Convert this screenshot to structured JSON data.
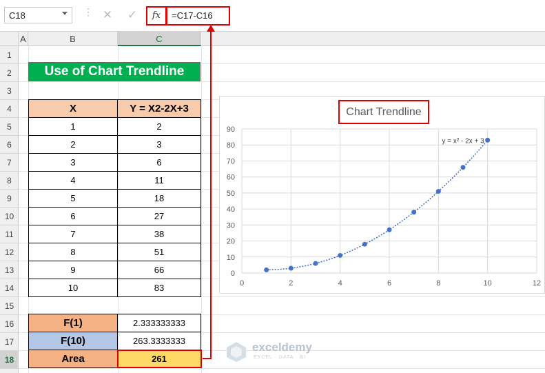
{
  "formula_bar": {
    "name_box": "C18",
    "fx_label": "fx",
    "formula": "=C17-C16",
    "cancel_glyph": "✕",
    "enter_glyph": "✓"
  },
  "columns": [
    "A",
    "B",
    "C"
  ],
  "rows": [
    "1",
    "2",
    "3",
    "4",
    "5",
    "6",
    "7",
    "8",
    "9",
    "10",
    "11",
    "12",
    "13",
    "14",
    "15",
    "16",
    "17",
    "18"
  ],
  "sheet": {
    "title": "Use of Chart Trendline",
    "table_headers": [
      "X",
      "Y = X2-2X+3"
    ],
    "table_rows": [
      [
        "1",
        "2"
      ],
      [
        "2",
        "3"
      ],
      [
        "3",
        "6"
      ],
      [
        "4",
        "11"
      ],
      [
        "5",
        "18"
      ],
      [
        "6",
        "27"
      ],
      [
        "7",
        "38"
      ],
      [
        "8",
        "51"
      ],
      [
        "9",
        "66"
      ],
      [
        "10",
        "83"
      ]
    ],
    "f1_label": "F(1)",
    "f1_value": "2.333333333",
    "f10_label": "F(10)",
    "f10_value": "263.3333333",
    "area_label": "Area",
    "area_value": "261"
  },
  "chart_data": {
    "type": "scatter",
    "title": "Chart Trendline",
    "x": [
      1,
      2,
      3,
      4,
      5,
      6,
      7,
      8,
      9,
      10
    ],
    "y": [
      2,
      3,
      6,
      11,
      18,
      27,
      38,
      51,
      66,
      83
    ],
    "trendline": "polynomial",
    "trendline_equation": "y = x² - 2x + 3",
    "xlim": [
      0,
      12
    ],
    "ylim": [
      0,
      90
    ],
    "x_ticks": [
      "0",
      "2",
      "4",
      "6",
      "8",
      "10",
      "12"
    ],
    "y_ticks": [
      "0",
      "10",
      "20",
      "30",
      "40",
      "50",
      "60",
      "70",
      "80",
      "90"
    ],
    "grid": true,
    "point_color": "#4472c4",
    "trend_color": "#4472c4"
  },
  "watermark": {
    "name": "exceldemy",
    "tagline": "EXCEL · DATA · BI"
  },
  "colors": {
    "highlight_red": "#e00000",
    "title_green": "#00b050"
  }
}
